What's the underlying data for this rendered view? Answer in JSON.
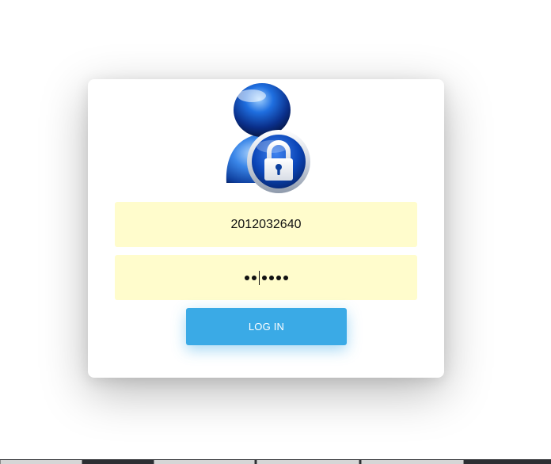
{
  "login": {
    "icon": "user-lock-icon",
    "username_value": "2012032640",
    "password_value": "●●●●●●",
    "password_dot_count": 6,
    "button_label": "LOG IN"
  },
  "colors": {
    "field_background": "#fffccc",
    "button_background": "#3aaae6",
    "button_text": "#ffffff"
  }
}
